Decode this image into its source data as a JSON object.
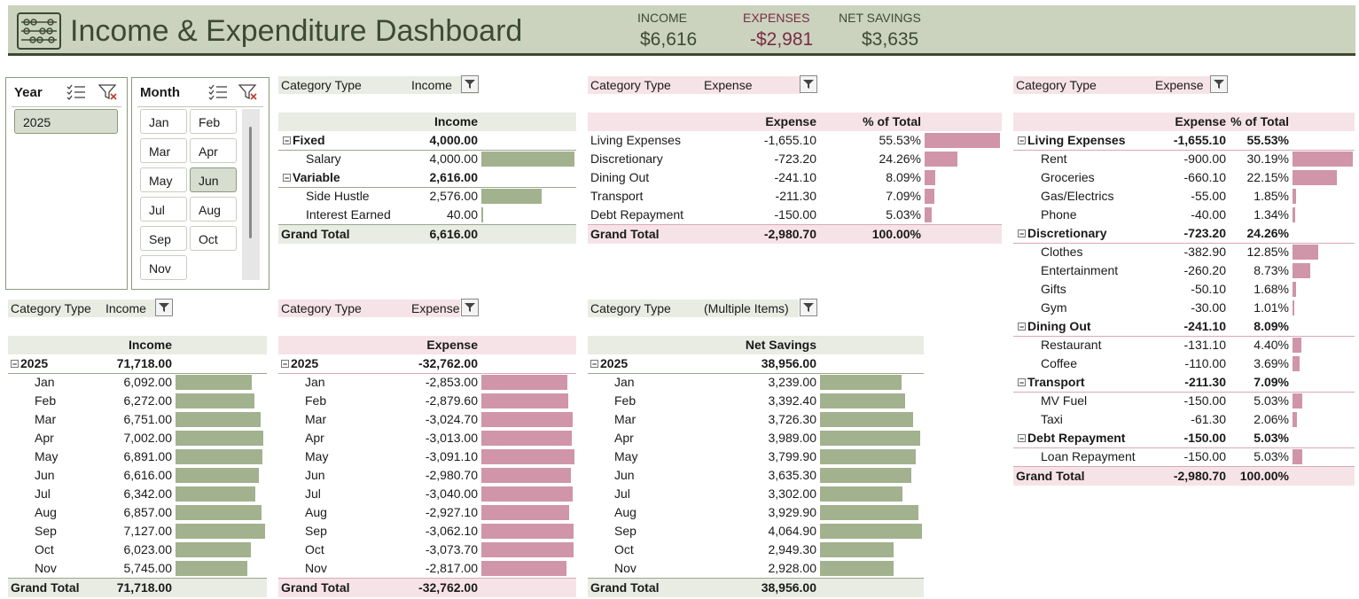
{
  "header": {
    "title": "Income & Expenditure Dashboard",
    "income_label": "INCOME",
    "income_value": "$6,616",
    "expenses_label": "EXPENSES",
    "expenses_value": "-$2,981",
    "net_label": "NET SAVINGS",
    "net_value": "$3,635",
    "icon": "abacus-icon"
  },
  "slicers": {
    "year": {
      "title": "Year",
      "items": [
        "2025"
      ],
      "selected": "2025"
    },
    "month": {
      "title": "Month",
      "items": [
        "Jan",
        "Feb",
        "Mar",
        "Apr",
        "May",
        "Jun",
        "Jul",
        "Aug",
        "Sep",
        "Oct",
        "Nov"
      ],
      "selected": "Jun"
    }
  },
  "income_table": {
    "filter_label": "Category Type",
    "filter_value": "Income",
    "header": "Income",
    "rows": [
      {
        "label": "Fixed",
        "value": "4,000.00",
        "group": true
      },
      {
        "label": "Salary",
        "value": "4,000.00",
        "bar": 1.0
      },
      {
        "label": "Variable",
        "value": "2,616.00",
        "group": true
      },
      {
        "label": "Side Hustle",
        "value": "2,576.00",
        "bar": 0.644
      },
      {
        "label": "Interest Earned",
        "value": "40.00",
        "bar": 0.01
      }
    ],
    "total_label": "Grand Total",
    "total_value": "6,616.00"
  },
  "expense_table": {
    "filter_label": "Category Type",
    "filter_value": "Expense",
    "header_expense": "Expense",
    "header_pct": "% of Total",
    "rows": [
      {
        "label": "Living Expenses",
        "value": "-1,655.10",
        "pct": "55.53%",
        "bar": 1.0
      },
      {
        "label": "Discretionary",
        "value": "-723.20",
        "pct": "24.26%",
        "bar": 0.437
      },
      {
        "label": "Dining Out",
        "value": "-241.10",
        "pct": "8.09%",
        "bar": 0.146
      },
      {
        "label": "Transport",
        "value": "-211.30",
        "pct": "7.09%",
        "bar": 0.128
      },
      {
        "label": "Debt Repayment",
        "value": "-150.00",
        "pct": "5.03%",
        "bar": 0.091
      }
    ],
    "total_label": "Grand Total",
    "total_value": "-2,980.70",
    "total_pct": "100.00%"
  },
  "detail_table": {
    "filter_label": "Category Type",
    "filter_value": "Expense",
    "header_expense": "Expense",
    "header_pct": "% of Total",
    "rows": [
      {
        "label": "Living Expenses",
        "value": "-1,655.10",
        "pct": "55.53%",
        "group": true
      },
      {
        "label": "Rent",
        "value": "-900.00",
        "pct": "30.19%",
        "bar": 1.0
      },
      {
        "label": "Groceries",
        "value": "-660.10",
        "pct": "22.15%",
        "bar": 0.733
      },
      {
        "label": "Gas/Electrics",
        "value": "-55.00",
        "pct": "1.85%",
        "bar": 0.061
      },
      {
        "label": "Phone",
        "value": "-40.00",
        "pct": "1.34%",
        "bar": 0.044
      },
      {
        "label": "Discretionary",
        "value": "-723.20",
        "pct": "24.26%",
        "group": true
      },
      {
        "label": "Clothes",
        "value": "-382.90",
        "pct": "12.85%",
        "bar": 0.425
      },
      {
        "label": "Entertainment",
        "value": "-260.20",
        "pct": "8.73%",
        "bar": 0.289
      },
      {
        "label": "Gifts",
        "value": "-50.10",
        "pct": "1.68%",
        "bar": 0.056
      },
      {
        "label": "Gym",
        "value": "-30.00",
        "pct": "1.01%",
        "bar": 0.033
      },
      {
        "label": "Dining Out",
        "value": "-241.10",
        "pct": "8.09%",
        "group": true
      },
      {
        "label": "Restaurant",
        "value": "-131.10",
        "pct": "4.40%",
        "bar": 0.146
      },
      {
        "label": "Coffee",
        "value": "-110.00",
        "pct": "3.69%",
        "bar": 0.122
      },
      {
        "label": "Transport",
        "value": "-211.30",
        "pct": "7.09%",
        "group": true
      },
      {
        "label": "MV Fuel",
        "value": "-150.00",
        "pct": "5.03%",
        "bar": 0.167
      },
      {
        "label": "Taxi",
        "value": "-61.30",
        "pct": "2.06%",
        "bar": 0.068
      },
      {
        "label": "Debt Repayment",
        "value": "-150.00",
        "pct": "5.03%",
        "group": true
      },
      {
        "label": "Loan Repayment",
        "value": "-150.00",
        "pct": "5.03%",
        "bar": 0.167
      }
    ],
    "total_label": "Grand Total",
    "total_value": "-2,980.70",
    "total_pct": "100.00%"
  },
  "monthly_income": {
    "filter_label": "Category Type",
    "filter_value": "Income",
    "header": "Income",
    "year_label": "2025",
    "year_value": "71,718.00",
    "rows": [
      {
        "label": "Jan",
        "value": "6,092.00",
        "bar": 0.855
      },
      {
        "label": "Feb",
        "value": "6,272.00",
        "bar": 0.88
      },
      {
        "label": "Mar",
        "value": "6,751.00",
        "bar": 0.947
      },
      {
        "label": "Apr",
        "value": "7,002.00",
        "bar": 0.982
      },
      {
        "label": "May",
        "value": "6,891.00",
        "bar": 0.967
      },
      {
        "label": "Jun",
        "value": "6,616.00",
        "bar": 0.928
      },
      {
        "label": "Jul",
        "value": "6,342.00",
        "bar": 0.89
      },
      {
        "label": "Aug",
        "value": "6,857.00",
        "bar": 0.962
      },
      {
        "label": "Sep",
        "value": "7,127.00",
        "bar": 1.0
      },
      {
        "label": "Oct",
        "value": "6,023.00",
        "bar": 0.845
      },
      {
        "label": "Nov",
        "value": "5,745.00",
        "bar": 0.806
      }
    ],
    "total_label": "Grand Total",
    "total_value": "71,718.00"
  },
  "monthly_expense": {
    "filter_label": "Category Type",
    "filter_value": "Expense",
    "header": "Expense",
    "year_label": "2025",
    "year_value": "-32,762.00",
    "rows": [
      {
        "label": "Jan",
        "value": "-2,853.00",
        "bar": 0.923
      },
      {
        "label": "Feb",
        "value": "-2,879.60",
        "bar": 0.932
      },
      {
        "label": "Mar",
        "value": "-3,024.70",
        "bar": 0.979
      },
      {
        "label": "Apr",
        "value": "-3,013.00",
        "bar": 0.975
      },
      {
        "label": "May",
        "value": "-3,091.10",
        "bar": 1.0
      },
      {
        "label": "Jun",
        "value": "-2,980.70",
        "bar": 0.964
      },
      {
        "label": "Jul",
        "value": "-3,040.00",
        "bar": 0.983
      },
      {
        "label": "Aug",
        "value": "-2,927.10",
        "bar": 0.947
      },
      {
        "label": "Sep",
        "value": "-3,062.10",
        "bar": 0.991
      },
      {
        "label": "Oct",
        "value": "-3,073.70",
        "bar": 0.994
      },
      {
        "label": "Nov",
        "value": "-2,817.00",
        "bar": 0.911
      }
    ],
    "total_label": "Grand Total",
    "total_value": "-32,762.00"
  },
  "monthly_net": {
    "filter_label": "Category Type",
    "filter_value": "(Multiple Items)",
    "header": "Net Savings",
    "year_label": "2025",
    "year_value": "38,956.00",
    "rows": [
      {
        "label": "Jan",
        "value": "3,239.00",
        "bar": 0.797
      },
      {
        "label": "Feb",
        "value": "3,392.40",
        "bar": 0.835
      },
      {
        "label": "Mar",
        "value": "3,726.30",
        "bar": 0.917
      },
      {
        "label": "Apr",
        "value": "3,989.00",
        "bar": 0.981
      },
      {
        "label": "May",
        "value": "3,799.90",
        "bar": 0.935
      },
      {
        "label": "Jun",
        "value": "3,635.30",
        "bar": 0.894
      },
      {
        "label": "Jul",
        "value": "3,302.00",
        "bar": 0.812
      },
      {
        "label": "Aug",
        "value": "3,929.90",
        "bar": 0.967
      },
      {
        "label": "Sep",
        "value": "4,064.90",
        "bar": 1.0
      },
      {
        "label": "Oct",
        "value": "2,949.30",
        "bar": 0.726
      },
      {
        "label": "Nov",
        "value": "2,928.00",
        "bar": 0.72
      }
    ],
    "total_label": "Grand Total",
    "total_value": "38,956.00"
  },
  "colors": {
    "income_bar": "#a2b18e",
    "expense_bar": "#d095a8",
    "header_bg": "#cbd3bf",
    "brand": "#3d4a33"
  }
}
